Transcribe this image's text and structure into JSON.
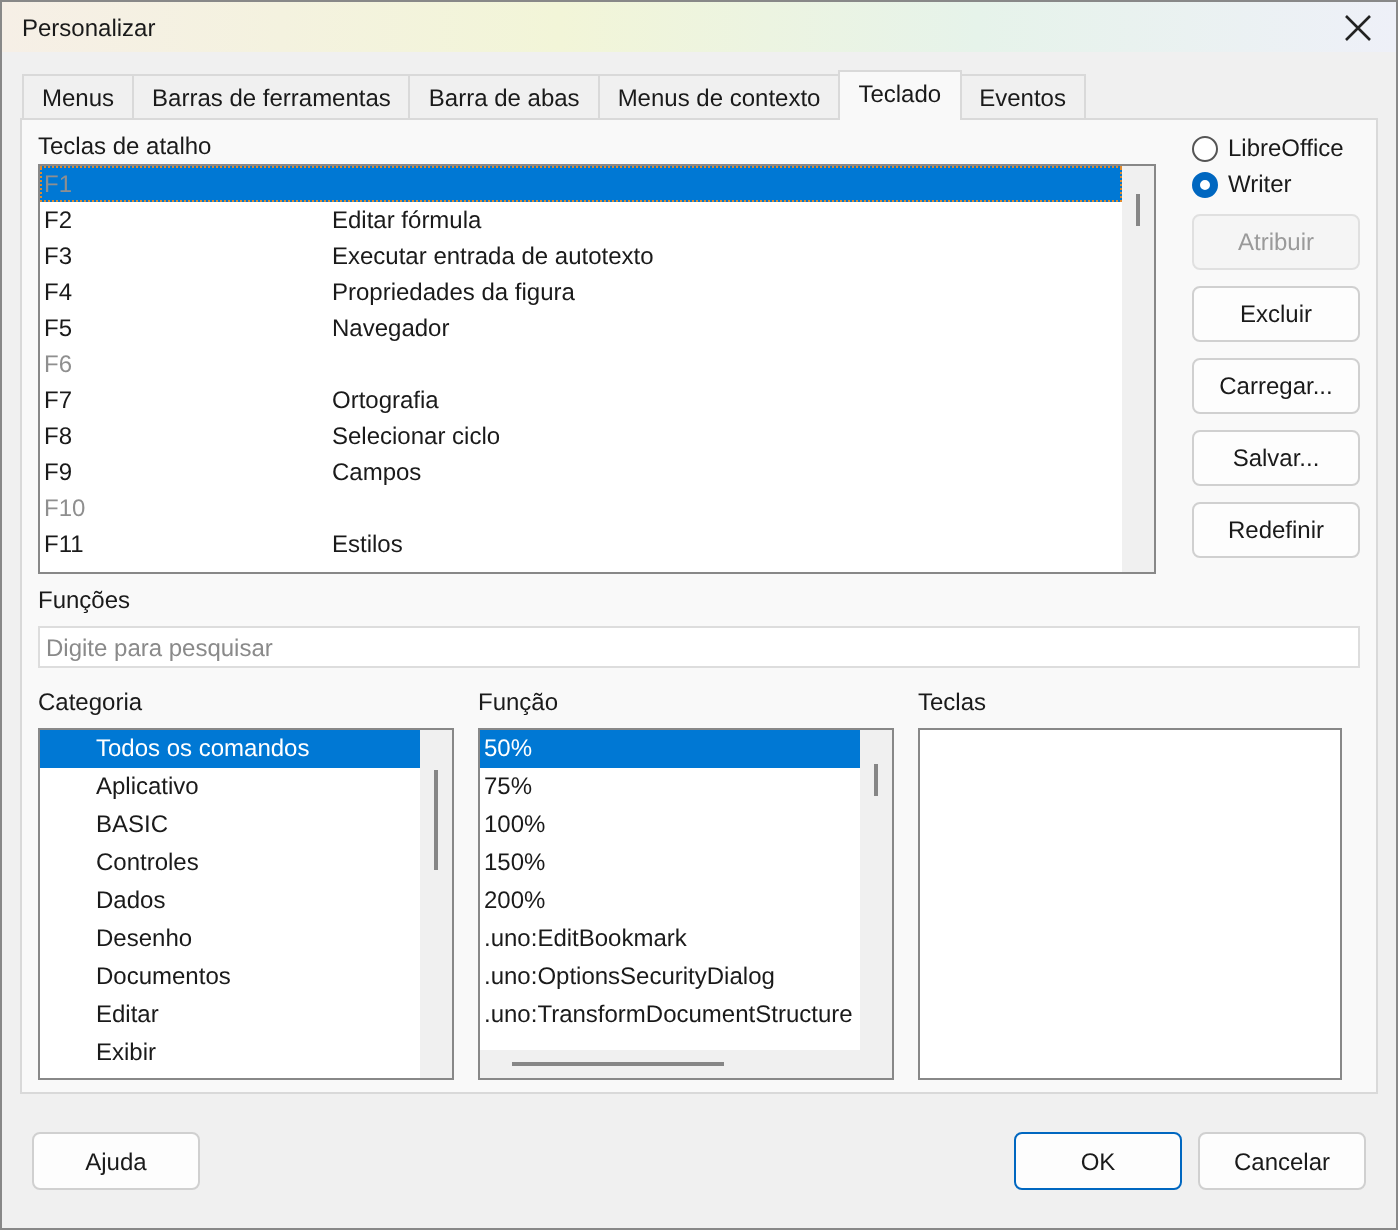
{
  "window": {
    "title": "Personalizar"
  },
  "tabs": [
    {
      "label": "Menus",
      "selected": false
    },
    {
      "label": "Barras de ferramentas",
      "selected": false
    },
    {
      "label": "Barra de abas",
      "selected": false
    },
    {
      "label": "Menus de contexto",
      "selected": false
    },
    {
      "label": "Teclado",
      "selected": true
    },
    {
      "label": "Eventos",
      "selected": false
    }
  ],
  "shortcuts": {
    "label": "Teclas de atalho",
    "rows": [
      {
        "key": "F1",
        "disabled": true,
        "selected": true
      },
      {
        "key": "F2",
        "function": "Editar fórmula",
        "disabled": false,
        "selected": false
      },
      {
        "key": "F3",
        "function": "Executar entrada de autotexto",
        "disabled": false,
        "selected": false
      },
      {
        "key": "F4",
        "function": "Propriedades da figura",
        "disabled": false,
        "selected": false
      },
      {
        "key": "F5",
        "function": "Navegador",
        "disabled": false,
        "selected": false
      },
      {
        "key": "F6",
        "disabled": true,
        "selected": false
      },
      {
        "key": "F7",
        "function": "Ortografia",
        "disabled": false,
        "selected": false
      },
      {
        "key": "F8",
        "function": "Selecionar ciclo",
        "disabled": false,
        "selected": false
      },
      {
        "key": "F9",
        "function": "Campos",
        "disabled": false,
        "selected": false
      },
      {
        "key": "F10",
        "disabled": true,
        "selected": false
      },
      {
        "key": "F11",
        "function": "Estilos",
        "disabled": false,
        "selected": false
      }
    ]
  },
  "scope": [
    {
      "label": "LibreOffice",
      "selected": false
    },
    {
      "label": "Writer",
      "selected": true
    }
  ],
  "side_buttons": [
    {
      "label": "Atribuir",
      "disabled": true
    },
    {
      "label": "Excluir",
      "disabled": false
    },
    {
      "label": "Carregar...",
      "disabled": false
    },
    {
      "label": "Salvar...",
      "disabled": false
    },
    {
      "label": "Redefinir",
      "disabled": false
    }
  ],
  "functions_label": "Funções",
  "search": {
    "placeholder": "Digite para pesquisar"
  },
  "category": {
    "label": "Categoria",
    "items": [
      {
        "label": "Todos os comandos",
        "selected": true
      },
      {
        "label": "Aplicativo",
        "selected": false
      },
      {
        "label": "BASIC",
        "selected": false
      },
      {
        "label": "Controles",
        "selected": false
      },
      {
        "label": "Dados",
        "selected": false
      },
      {
        "label": "Desenho",
        "selected": false
      },
      {
        "label": "Documentos",
        "selected": false
      },
      {
        "label": "Editar",
        "selected": false
      },
      {
        "label": "Exibir",
        "selected": false
      }
    ]
  },
  "function": {
    "label": "Função",
    "items": [
      {
        "label": "50%",
        "selected": true
      },
      {
        "label": "75%",
        "selected": false
      },
      {
        "label": "100%",
        "selected": false
      },
      {
        "label": "150%",
        "selected": false
      },
      {
        "label": "200%",
        "selected": false
      },
      {
        "label": ".uno:EditBookmark",
        "selected": false
      },
      {
        "label": ".uno:OptionsSecurityDialog",
        "selected": false
      },
      {
        "label": ".uno:TransformDocumentStructure",
        "selected": false
      }
    ]
  },
  "keys": {
    "label": "Teclas"
  },
  "buttons": [
    {
      "label": "Ajuda",
      "default": false
    },
    {
      "label": "OK",
      "default": true
    },
    {
      "label": "Cancelar",
      "default": false
    }
  ]
}
